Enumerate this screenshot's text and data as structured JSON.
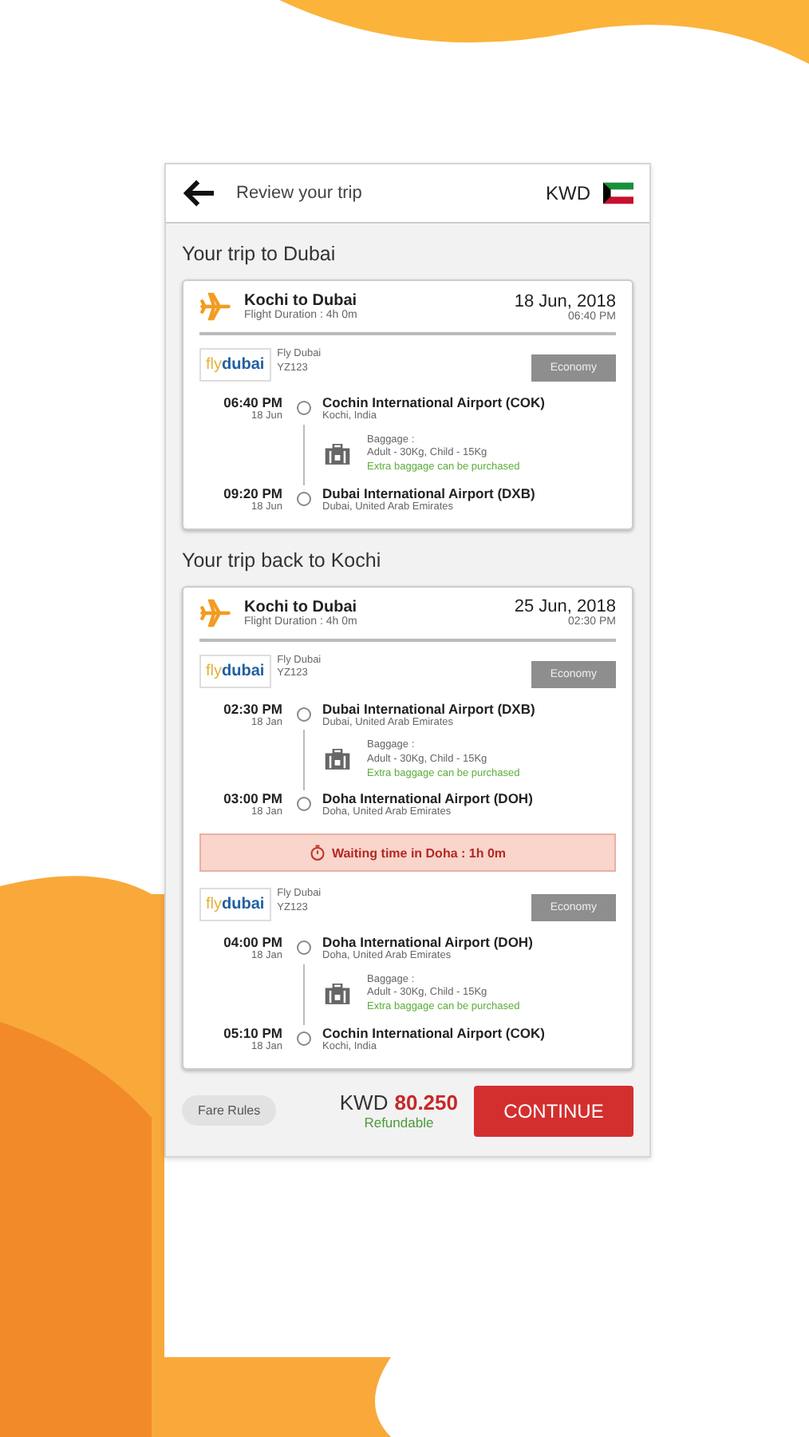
{
  "header": {
    "title": "Review your trip",
    "currency": "KWD"
  },
  "trips": [
    {
      "heading": "Your trip to Dubai",
      "route": "Kochi to Dubai",
      "duration": "Flight Duration : 4h 0m",
      "date": "18 Jun, 2018",
      "time": "06:40 PM",
      "items": [
        {
          "kind": "segment",
          "logo_a": "fly",
          "logo_b": "dubai",
          "airline": "Fly Dubai",
          "flight": "YZ123",
          "cabin": "Economy",
          "stops": [
            {
              "time": "06:40 PM",
              "date": "18 Jun",
              "airport": "Cochin International Airport (COK)",
              "city": "Kochi, India"
            },
            {
              "time": "09:20 PM",
              "date": "18 Jun",
              "airport": "Dubai International Airport (DXB)",
              "city": "Dubai, United Arab Emirates"
            }
          ],
          "baggage": {
            "label": "Baggage :",
            "detail": "Adult - 30Kg, Child - 15Kg",
            "extra": "Extra baggage can be purchased"
          }
        }
      ]
    },
    {
      "heading": "Your trip back to Kochi",
      "route": "Kochi to Dubai",
      "duration": "Flight Duration : 4h 0m",
      "date": "25 Jun, 2018",
      "time": "02:30 PM",
      "items": [
        {
          "kind": "segment",
          "logo_a": "fly",
          "logo_b": "dubai",
          "airline": "Fly Dubai",
          "flight": "YZ123",
          "cabin": "Economy",
          "stops": [
            {
              "time": "02:30 PM",
              "date": "18 Jan",
              "airport": "Dubai International Airport (DXB)",
              "city": "Dubai, United Arab Emirates"
            },
            {
              "time": "03:00 PM",
              "date": "18 Jan",
              "airport": "Doha International Airport (DOH)",
              "city": "Doha, United Arab Emirates"
            }
          ],
          "baggage": {
            "label": "Baggage :",
            "detail": "Adult - 30Kg, Child - 15Kg",
            "extra": "Extra baggage can be purchased"
          }
        },
        {
          "kind": "layover",
          "text": "Waiting time in Doha : 1h 0m"
        },
        {
          "kind": "segment",
          "logo_a": "fly",
          "logo_b": "dubai",
          "airline": "Fly Dubai",
          "flight": "YZ123",
          "cabin": "Economy",
          "stops": [
            {
              "time": "04:00 PM",
              "date": "18 Jan",
              "airport": "Doha International Airport (DOH)",
              "city": "Doha, United Arab Emirates"
            },
            {
              "time": "05:10 PM",
              "date": "18 Jan",
              "airport": "Cochin International Airport (COK)",
              "city": "Kochi, India"
            }
          ],
          "baggage": {
            "label": "Baggage :",
            "detail": "Adult - 30Kg, Child - 15Kg",
            "extra": "Extra baggage can be purchased"
          }
        }
      ]
    }
  ],
  "footer": {
    "fare_rules": "Fare Rules",
    "currency": "KWD",
    "amount": "80.250",
    "refund": "Refundable",
    "button": "CONTINUE"
  }
}
